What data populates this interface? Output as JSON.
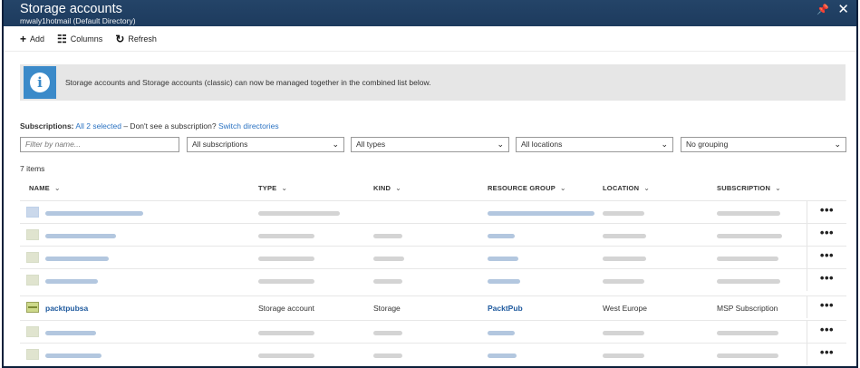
{
  "header": {
    "title": "Storage accounts",
    "subtitle": "mwaly1hotmail (Default Directory)"
  },
  "toolbar": {
    "add_label": "Add",
    "columns_label": "Columns",
    "refresh_label": "Refresh"
  },
  "banner": {
    "message": "Storage accounts and Storage accounts (classic) can now be managed together in the combined list below."
  },
  "subscriptions": {
    "label": "Subscriptions:",
    "selected": "All 2 selected",
    "prompt": " – Don't see a subscription? ",
    "switch_link": "Switch directories"
  },
  "filters": {
    "name_placeholder": "Filter by name...",
    "subscriptions": "All subscriptions",
    "types": "All types",
    "locations": "All locations",
    "grouping": "No grouping"
  },
  "list": {
    "count": "7 items",
    "columns": [
      "NAME",
      "TYPE",
      "KIND",
      "RESOURCE GROUP",
      "LOCATION",
      "SUBSCRIPTION"
    ],
    "visible_row": {
      "name": "packtpubsa",
      "type": "Storage account",
      "kind": "Storage",
      "resource_group": "PacktPub",
      "location": "West Europe",
      "subscription": "MSP Subscription"
    },
    "more_label": "•••"
  },
  "colors": {
    "titlebar": "#1d3b5e",
    "accent_link": "#2a72c2",
    "info_icon": "#3b8ac9",
    "banner_bg": "#e6e6e6"
  }
}
